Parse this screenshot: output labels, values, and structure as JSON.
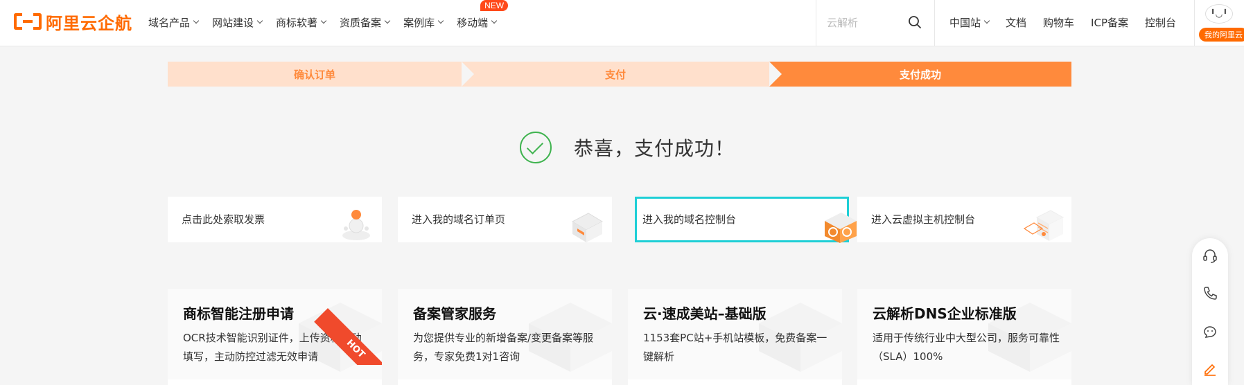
{
  "header": {
    "logo_text": "阿里云企航",
    "nav": [
      {
        "label": "域名产品"
      },
      {
        "label": "网站建设"
      },
      {
        "label": "商标软著"
      },
      {
        "label": "资质备案"
      },
      {
        "label": "案例库"
      },
      {
        "label": "移动端",
        "badge": "NEW"
      }
    ],
    "search_placeholder": "云解析",
    "right_nav": [
      {
        "label": "中国站",
        "has_dropdown": true
      },
      {
        "label": "文档"
      },
      {
        "label": "购物车"
      },
      {
        "label": "ICP备案"
      },
      {
        "label": "控制台"
      }
    ],
    "user_avatar_face": "╹◡╹",
    "user_button": "我的阿里云"
  },
  "steps": [
    {
      "label": "确认订单",
      "state": "done"
    },
    {
      "label": "支付",
      "state": "done"
    },
    {
      "label": "支付成功",
      "state": "active"
    }
  ],
  "success": {
    "message": "恭喜，支付成功！"
  },
  "actions": [
    {
      "label": "点击此处索取发票",
      "icon": "invoice-illustration"
    },
    {
      "label": "进入我的域名订单页",
      "icon": "order-illustration"
    },
    {
      "label": "进入我的域名控制台",
      "icon": "domain-console-illustration",
      "selected": true
    },
    {
      "label": "进入云虚拟主机控制台",
      "icon": "host-console-illustration"
    }
  ],
  "products": [
    {
      "title": "商标智能注册申请",
      "desc": "OCR技术智能识别证件，上传资料自动填写，主动防控过滤无效申请",
      "badge": "HOT"
    },
    {
      "title": "备案管家服务",
      "desc": "为您提供专业的新增备案/变更备案等服务，专家免费1对1咨询"
    },
    {
      "title": "云·速成美站–基础版",
      "desc": "1153套PC站+手机站模板，免费备案一键解析"
    },
    {
      "title": "云解析DNS企业标准版",
      "desc": "适用于传统行业中大型公司，服务可靠性（SLA）100%"
    }
  ],
  "colors": {
    "brand": "#ff6a00",
    "step_done_bg": "#ffe0cc",
    "step_active_bg": "#ff8a3c",
    "success_green": "#3fb34f",
    "selected_border": "#1ecfd6"
  },
  "float_bar_icons": [
    "customer-service-icon",
    "phone-icon",
    "chat-bot-icon",
    "edit-feedback-icon"
  ]
}
